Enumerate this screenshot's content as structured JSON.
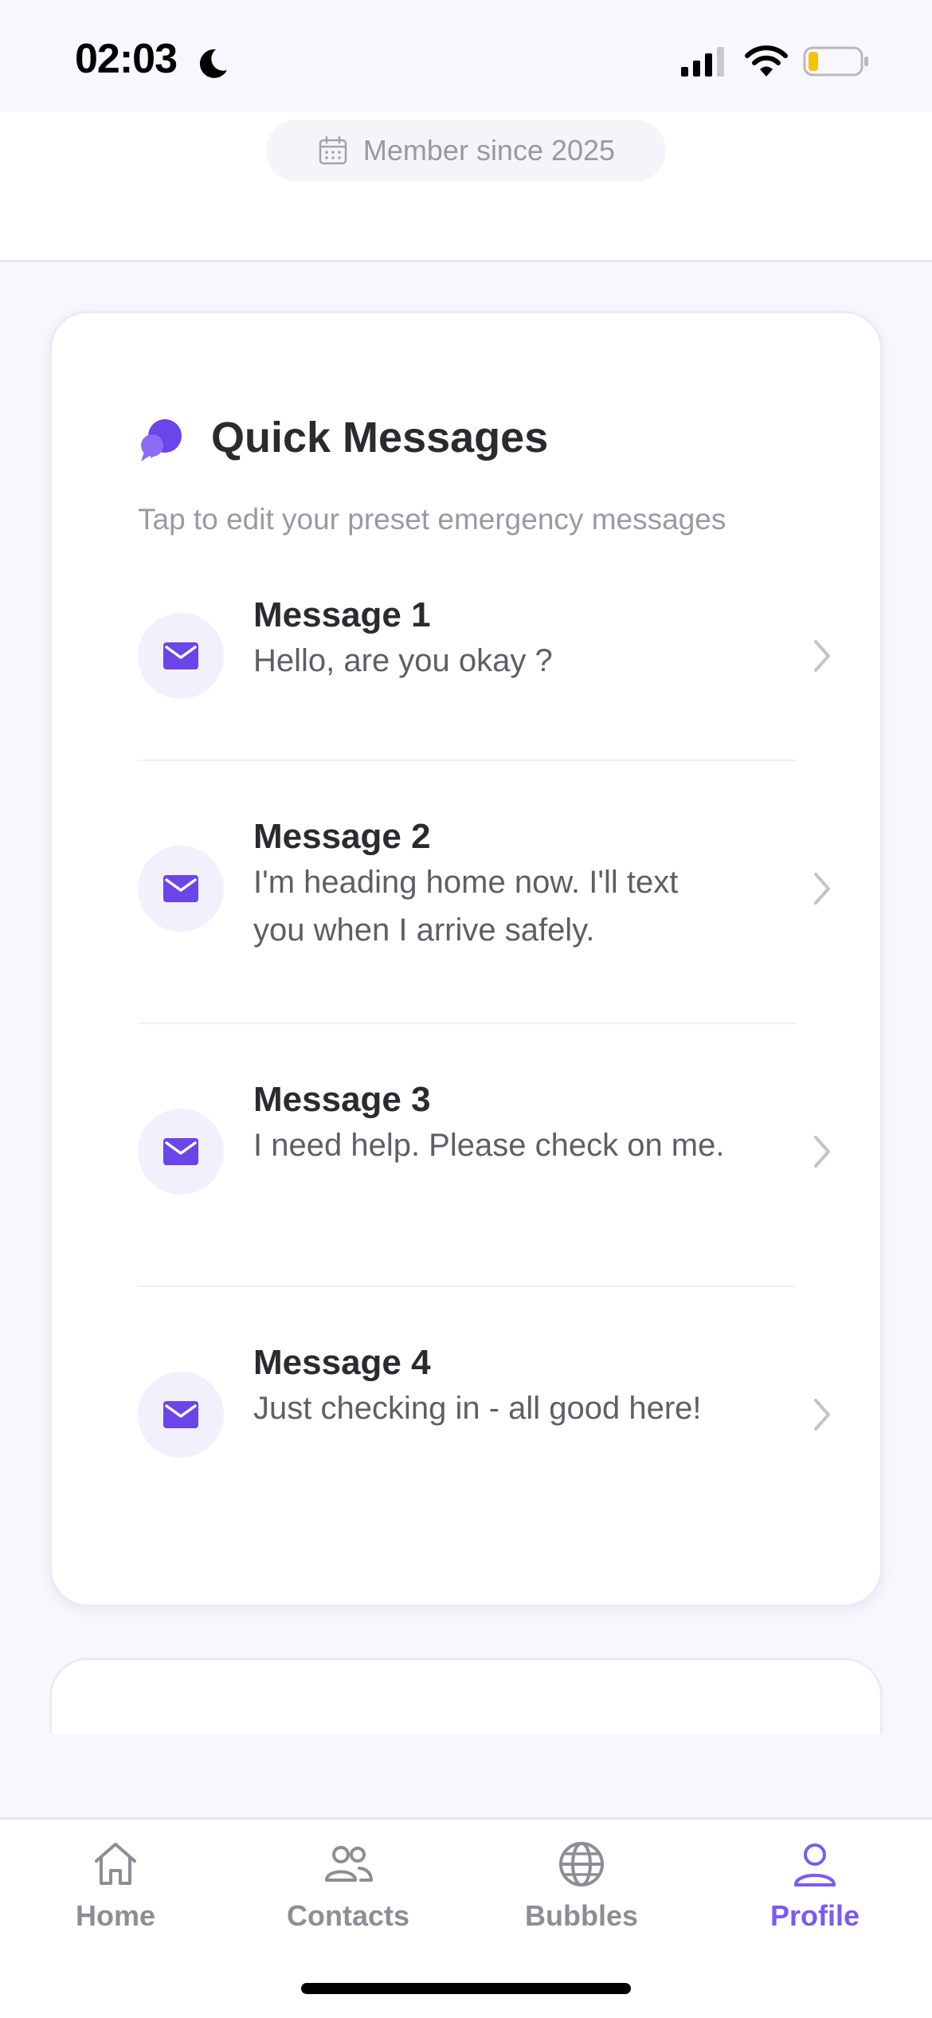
{
  "status_bar": {
    "time": "02:03",
    "icons": [
      "moon-icon",
      "signal-icon",
      "wifi-icon",
      "battery-icon"
    ]
  },
  "profile_header": {
    "member_since": "Member since 2025",
    "icon": "calendar-icon"
  },
  "quick_messages": {
    "title": "Quick Messages",
    "subtitle": "Tap to edit your preset emergency messages",
    "icon": "chat-bubbles-icon",
    "items": [
      {
        "title": "Message 1",
        "text": "Hello, are you okay ?",
        "icon": "envelope-icon"
      },
      {
        "title": "Message 2",
        "text": "I'm heading home now. I'll text you when I arrive safely.",
        "icon": "envelope-icon"
      },
      {
        "title": "Message 3",
        "text": "I need help. Please check on me.",
        "icon": "envelope-icon"
      },
      {
        "title": "Message 4",
        "text": "Just checking in - all good here!",
        "icon": "envelope-icon"
      }
    ]
  },
  "tab_bar": {
    "tabs": [
      {
        "label": "Home",
        "icon": "home-icon",
        "active": false
      },
      {
        "label": "Contacts",
        "icon": "contacts-icon",
        "active": false
      },
      {
        "label": "Bubbles",
        "icon": "globe-icon",
        "active": false
      },
      {
        "label": "Profile",
        "icon": "person-icon",
        "active": true
      }
    ]
  },
  "colors": {
    "accent": "#7a5af5",
    "background": "#f8f7fc",
    "card": "#ffffff",
    "muted_text": "#9a99a3",
    "icon_bg": "#f3f0fd"
  }
}
